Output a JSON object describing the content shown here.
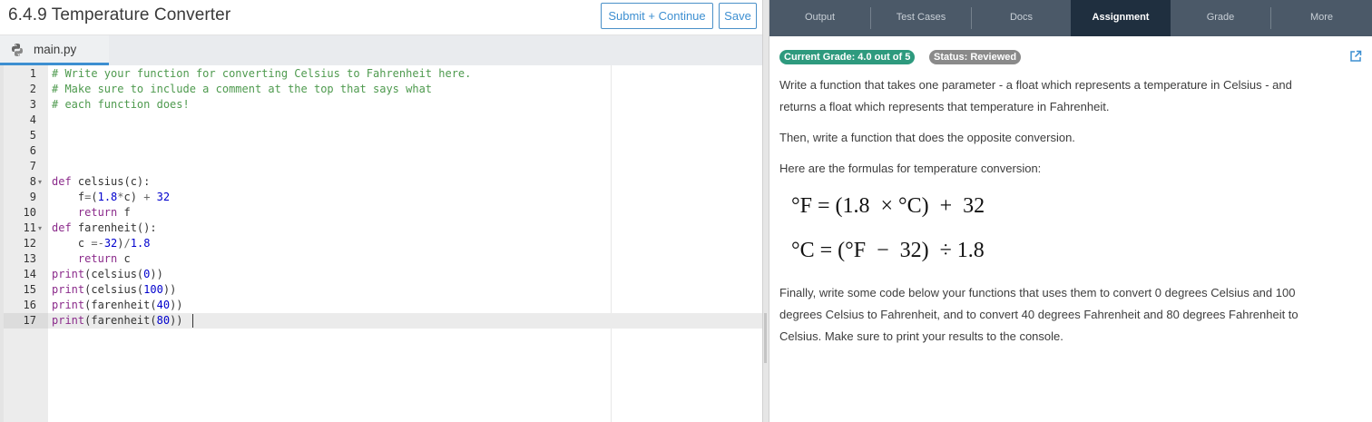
{
  "header": {
    "title": "6.4.9 Temperature Converter",
    "submit_label": "Submit + Continue",
    "save_label": "Save"
  },
  "file_tab": {
    "name": "main.py",
    "icon": "python-icon"
  },
  "editor": {
    "line_numbers": [
      "1",
      "2",
      "3",
      "4",
      "5",
      "6",
      "7",
      "8",
      "9",
      "10",
      "11",
      "12",
      "13",
      "14",
      "15",
      "16",
      "17"
    ],
    "active_line": 17,
    "fold_lines": [
      8,
      11
    ],
    "lines": [
      "# Write your function for converting Celsius to Fahrenheit here.",
      "# Make sure to include a comment at the top that says what",
      "# each function does!",
      "",
      "",
      "",
      "",
      "def celsius(c):",
      "    f=(1.8*c) + 32",
      "    return f",
      "def farenheit():",
      "    c =-32)/1.8",
      "    return c",
      "print(celsius(0))",
      "print(celsius(100))",
      "print(farenheit(40))",
      "print(farenheit(80))"
    ]
  },
  "tabs": [
    {
      "label": "Output",
      "active": false
    },
    {
      "label": "Test Cases",
      "active": false
    },
    {
      "label": "Docs",
      "active": false
    },
    {
      "label": "Assignment",
      "active": true
    },
    {
      "label": "Grade",
      "active": false
    },
    {
      "label": "More",
      "active": false
    }
  ],
  "assignment": {
    "grade_badge": "Current Grade: 4.0 out of 5",
    "status_badge": "Status: Reviewed",
    "external_icon": "external-link-icon",
    "para1_line1": "Write a function that takes one parameter - a float which represents a temperature in Celsius - and",
    "para1_line2": "returns a float which represents that temperature in Fahrenheit.",
    "para2": "Then, write a function that does the opposite conversion.",
    "para3": "Here are the formulas for temperature conversion:",
    "formula1": "°F = (1.8  × °C)  +  32",
    "formula2": "°C = (°F  −  32)  ÷ 1.8",
    "para4_line1": "Finally, write some code below your functions that uses them to convert 0 degrees Celsius and 100",
    "para4_line2": "degrees Celsius to Fahrenheit, and to convert 40 degrees Fahrenheit and 80 degrees Fahrenheit to",
    "para4_line3": "Celsius. Make sure to print your results to the console."
  },
  "colors": {
    "accent_blue": "#3d8fd1",
    "tab_bar": "#4b5968",
    "active_tab": "#1f2f3f",
    "grade_badge": "#2e9a7e",
    "status_badge": "#8a8a8a",
    "comment_green": "#4e9a4e",
    "keyword_purple": "#8b2b8b",
    "number_blue": "#0000cd"
  }
}
